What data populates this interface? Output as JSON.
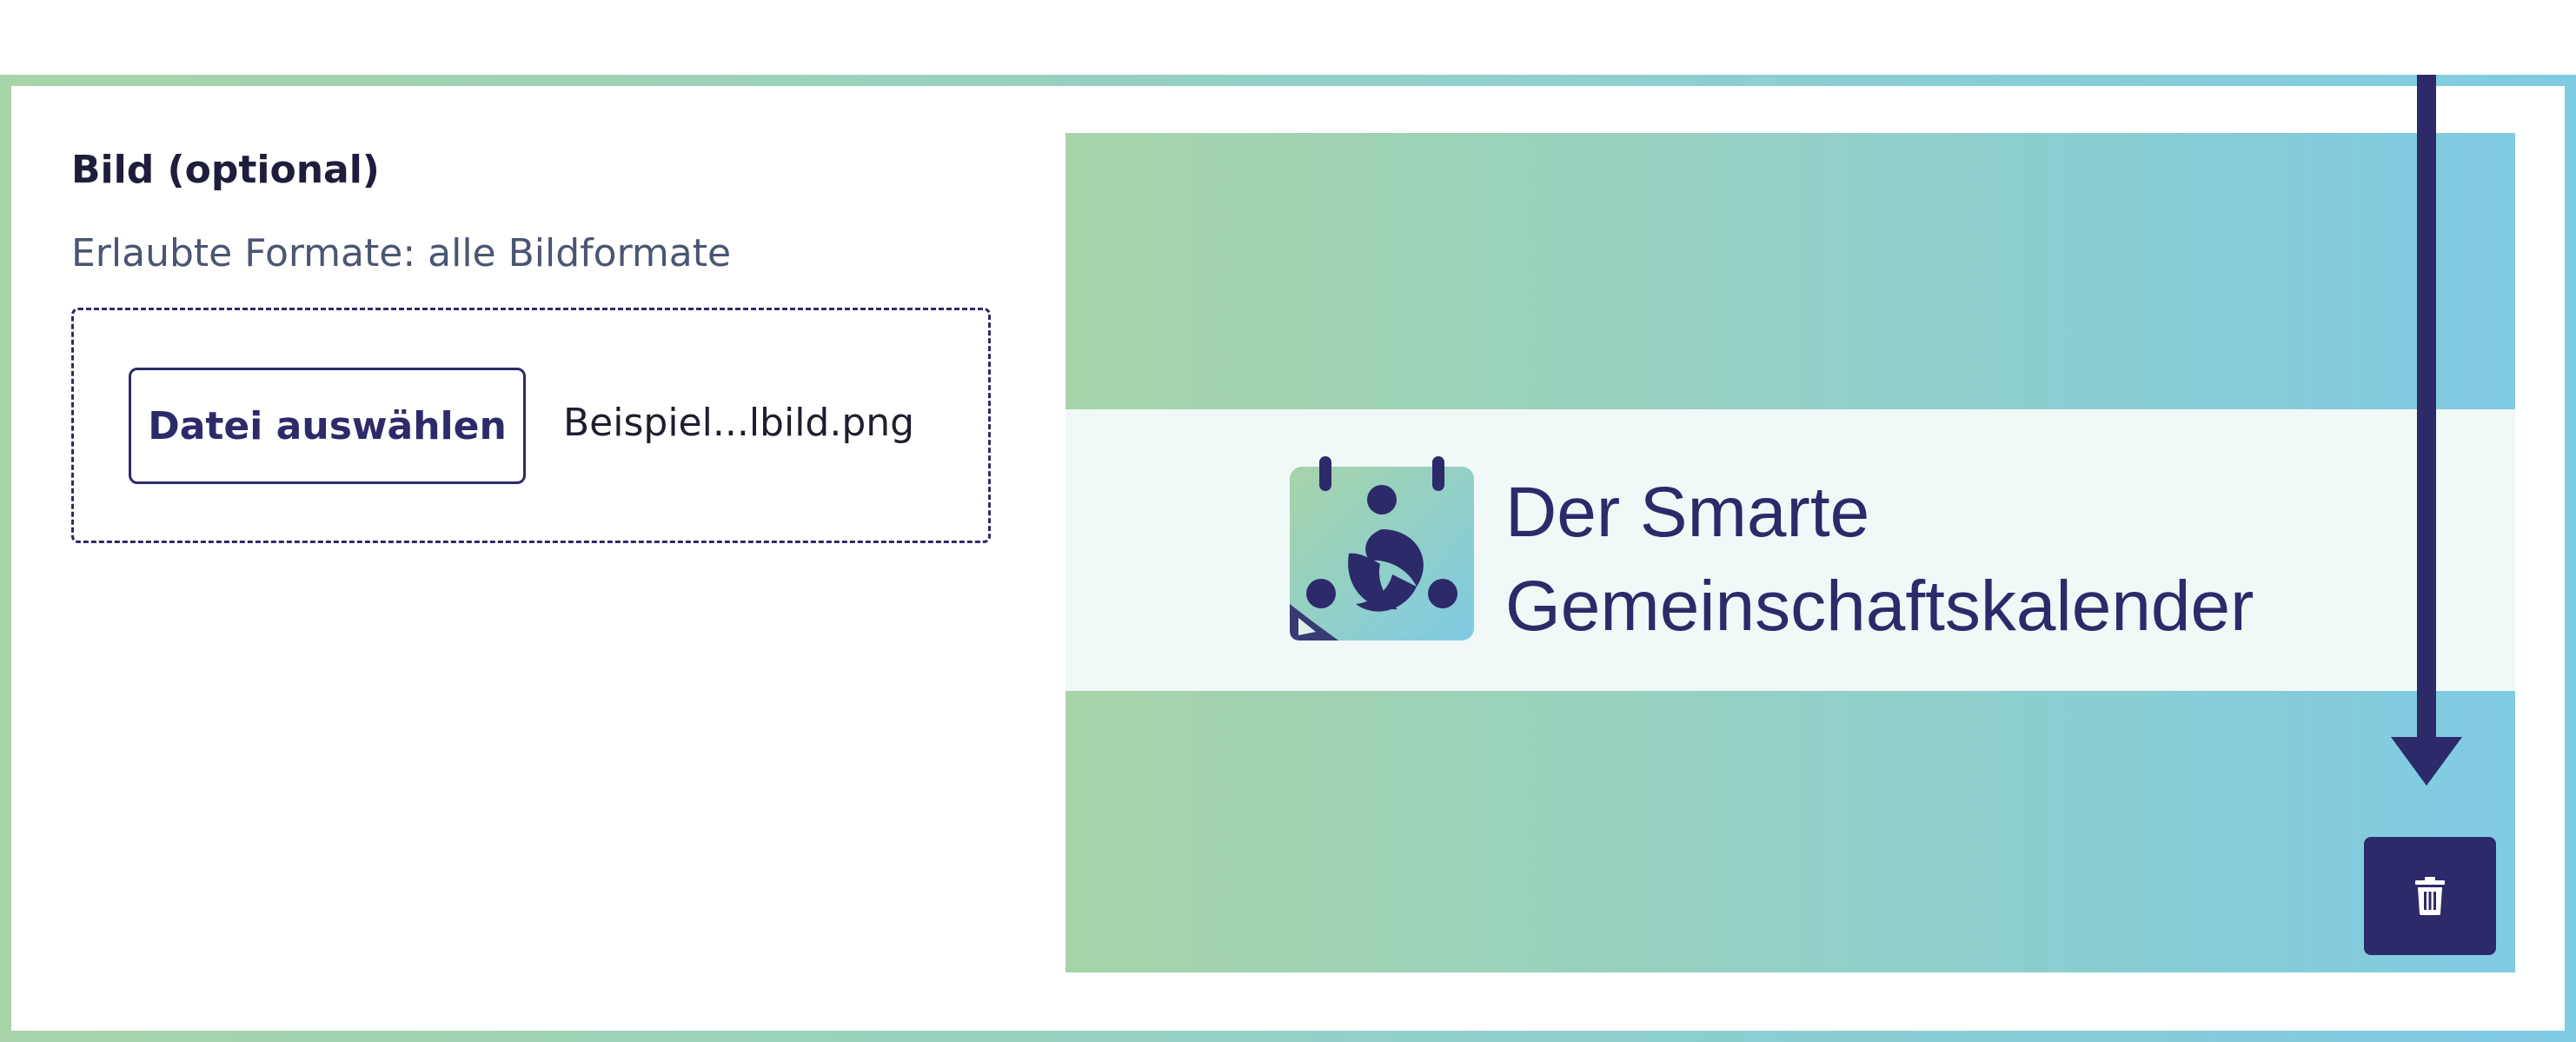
{
  "image_field": {
    "label": "Bild (optional)",
    "hint": "Erlaubte Formate: alle Bildformate",
    "choose_button_label": "Datei auswählen",
    "selected_file_name": "Beispiel...lbild.png"
  },
  "preview": {
    "logo_text_line1": "Der Smarte",
    "logo_text_line2": "Gemeinschaftskalender",
    "delete_icon": "trash-icon",
    "annotation_icon": "arrow-down-icon"
  },
  "colors": {
    "primary": "#2d2a6a",
    "gradient_green": "#a7d4a8",
    "gradient_blue": "#7fcbe4",
    "text_muted": "#4b5573"
  }
}
